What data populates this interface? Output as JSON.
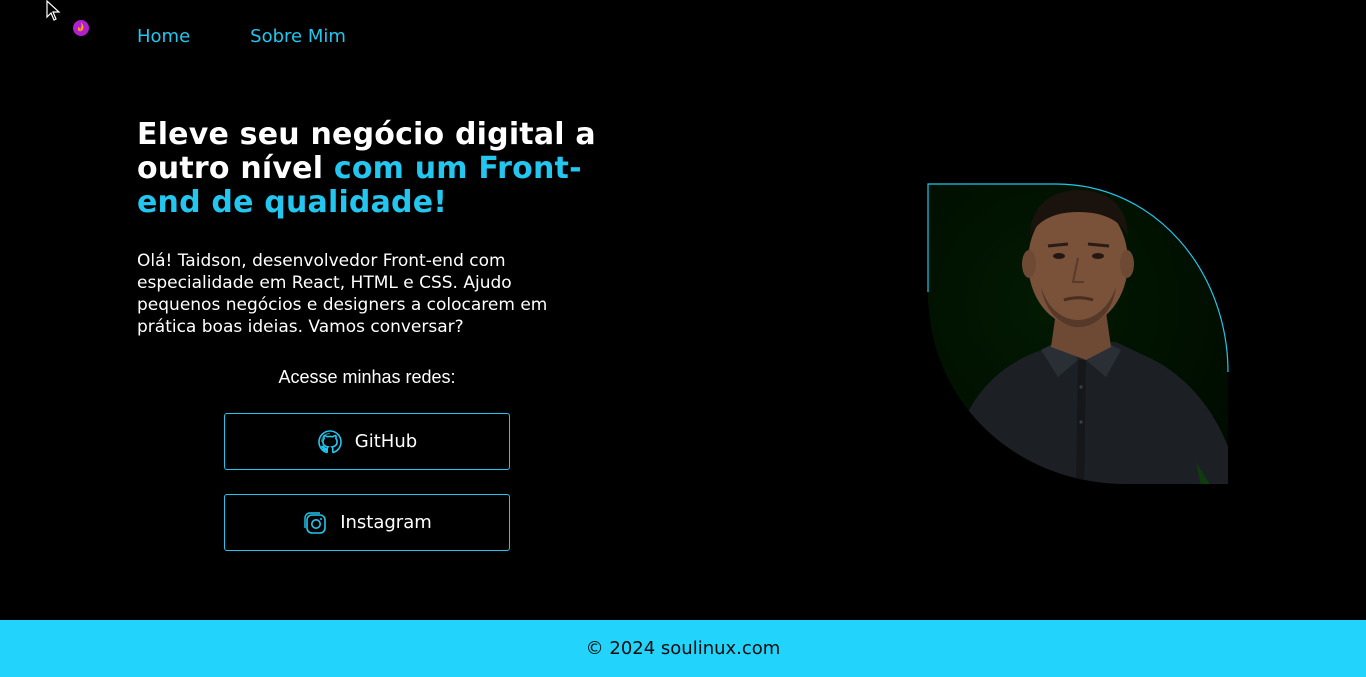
{
  "nav": {
    "items": [
      {
        "label": "Home"
      },
      {
        "label": "Sobre Mim"
      }
    ]
  },
  "hero": {
    "title_plain": "Eleve seu negócio digital a outro nível",
    "title_accent": "com um Front-end de qualidade!",
    "intro": "Olá! Taidson, desenvolvedor Front-end com especialidade em React, HTML e CSS. Ajudo pequenos negócios e designers a colocarem em prática boas ideias. Vamos conversar?"
  },
  "social": {
    "heading": "Acesse minhas redes:",
    "buttons": [
      {
        "label": "GitHub",
        "icon": "github-icon"
      },
      {
        "label": "Instagram",
        "icon": "instagram-icon"
      }
    ]
  },
  "footer": {
    "text": "© 2024 soulinux.com"
  },
  "colors": {
    "accent": "#22c6ee",
    "background": "#000000",
    "footer_bg": "#22d3fb",
    "text": "#ffffff"
  }
}
